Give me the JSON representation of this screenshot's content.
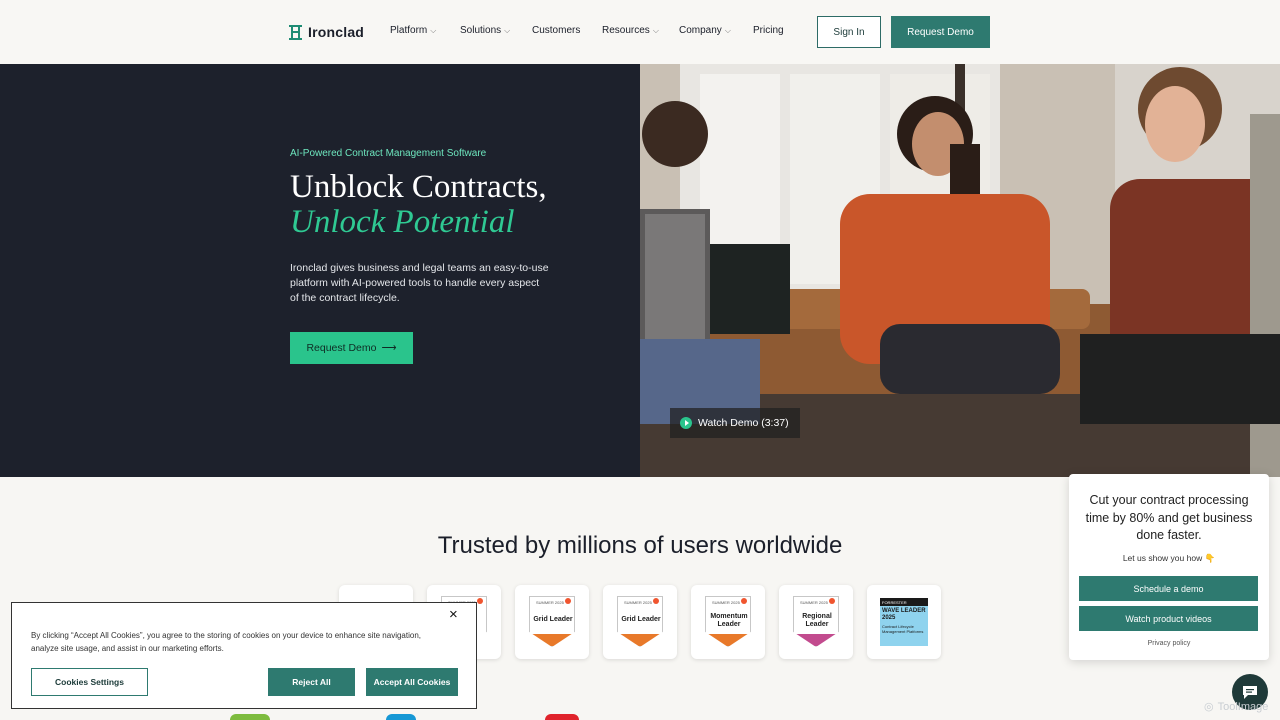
{
  "header": {
    "brand": "Ironclad",
    "nav": [
      {
        "label": "Platform",
        "has_menu": true
      },
      {
        "label": "Solutions",
        "has_menu": true
      },
      {
        "label": "Customers",
        "has_menu": false
      },
      {
        "label": "Resources",
        "has_menu": true
      },
      {
        "label": "Company",
        "has_menu": true
      },
      {
        "label": "Pricing",
        "has_menu": false
      }
    ],
    "sign_in": "Sign In",
    "request_demo": "Request Demo"
  },
  "hero": {
    "eyebrow": "AI-Powered Contract Management Software",
    "title_line1": "Unblock Contracts,",
    "title_line2": "Unlock Potential",
    "description": "Ironclad gives business and legal teams an easy-to-use platform with AI-powered tools to handle every aspect of the contract lifecycle.",
    "cta": "Request Demo",
    "cta_arrow": "⟶",
    "watch_demo": "Watch Demo (3:37)"
  },
  "trusted": {
    "heading": "Trusted by millions of users worldwide",
    "badges": [
      {
        "season": "SUMMER 2025",
        "label": "Leader"
      },
      {
        "season": "SUMMER 2025",
        "label": "Grid Leader",
        "band": "#e8792a"
      },
      {
        "season": "SUMMER 2025",
        "label": "Grid Leader",
        "band": "#e8792a"
      },
      {
        "season": "SUMMER 2025",
        "label": "Momentum Leader",
        "band": "#e8792a"
      },
      {
        "season": "SUMMER 2025",
        "label": "Regional Leader",
        "band": "#c24b8e"
      },
      {
        "header": "FORRESTER",
        "label": "WAVE LEADER 2025",
        "sub": "Contract Lifecycle Management Platforms"
      }
    ]
  },
  "cookie": {
    "text": "By clicking “Accept All Cookies”, you agree to the storing of cookies on your device to enhance site navigation, analyze site usage, and assist in our marketing efforts.",
    "settings": "Cookies Settings",
    "reject": "Reject All",
    "accept": "Accept All Cookies",
    "close": "×"
  },
  "chat": {
    "headline": "Cut your contract processing time by 80% and get business done faster.",
    "sub": "Let us show you how 👇",
    "schedule": "Schedule a demo",
    "videos": "Watch product videos",
    "privacy": "Privacy policy"
  },
  "watermark": "ToolImage",
  "colors": {
    "brand_green": "#2ac48c",
    "teal_button": "#2e7a70",
    "hero_dark": "#1d212c",
    "accent_italic": "#2fc993"
  }
}
